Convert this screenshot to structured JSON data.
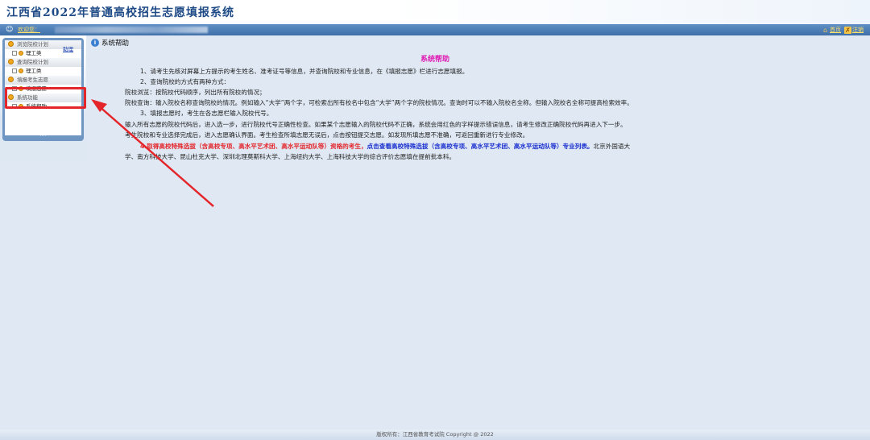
{
  "header": {
    "title": "江西省2022年普通高校招生志愿填报系统",
    "welcome_label": "欢迎您：",
    "home_link": "首页",
    "logout_link": "注销",
    "colors": {
      "bar": "#3e6fa8",
      "link": "#ffe26b",
      "title": "#1e4a86"
    }
  },
  "sidebar": {
    "help_link": "助理",
    "groups": [
      {
        "title": "浏览院校计划",
        "items": [
          "理工类"
        ]
      },
      {
        "title": "查询院校计划",
        "items": [
          "理工类"
        ]
      },
      {
        "title": "填报考生志愿",
        "items": [
          "填报志愿"
        ]
      },
      {
        "title": "系统功能",
        "items": [
          "系统帮助"
        ]
      }
    ]
  },
  "content": {
    "page_title": "系统帮助",
    "heading": "系统帮助",
    "lines": [
      "1、请考生先核对屏幕上方提示的考生姓名、准考证号等信息，并查询院校和专业信息，在《填报志愿》栏进行志愿填报。",
      "2、查询院校的方式有两种方式：",
      "院校浏览：按院校代码顺序，列出所有院校的情况；",
      "院校查询：输入院校名称查询院校的情况。例如输入“大学”两个字，可检索出所有校名中包含“大学”两个字的院校情况。查询时可以不输入院校名全称。但输入院校名全称可提高检索效率。",
      "3、填报志愿时，考生在各志愿栏输入院校代号。",
      "输入所有志愿的院校代码后，进入选一步，进行院校代号正确性检查。如果某个志愿输入的院校代码不正确，系统会用红色的字样提示错误信息，请考生修改正确院校代码再进入下一步。",
      "考生院校和专业选择完成后，进入志愿确认界面。考生检查所填志愿无误后，点击按钮提交志愿。如发现所填志愿不准确，可返回重新进行专业修改。"
    ],
    "line8_red": "4.取得高校特殊选拔（含高校专项、高水平艺术团、高水平运动队等）资格的考生，",
    "line8_blue": "点击查看高校特殊选拔（含高校专项、高水平艺术团、高水平运动队等）专业列表。",
    "line8_tail": "北京外国语大",
    "line9": "学、南方科技大学、昆山杜克大学、深圳北理莫斯科大学、上海纽约大学、上海科技大学的综合评价志愿填在提前批本科。",
    "colors": {
      "heading": "#e01ab4",
      "red": "#e4262b",
      "blue": "#1a2fd0"
    }
  },
  "footer": {
    "copyright": "版权所有：江西省教育考试院 Copyright @ 2022"
  }
}
